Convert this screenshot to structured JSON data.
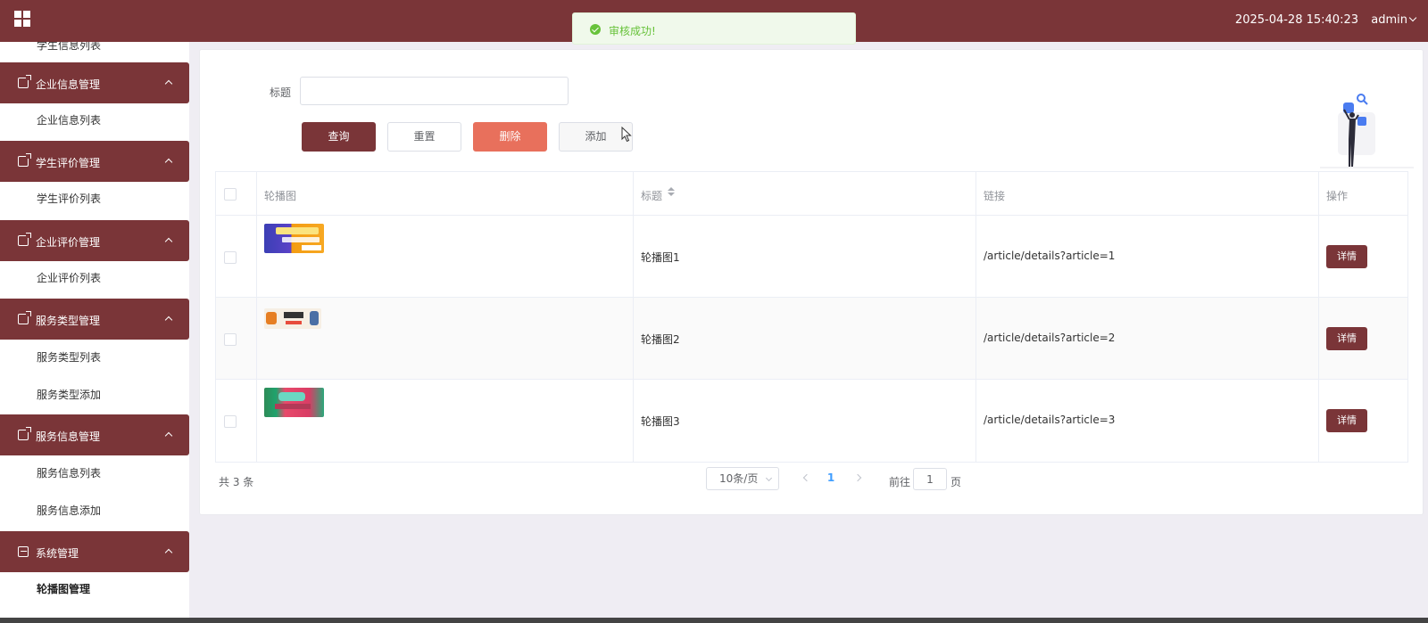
{
  "header": {
    "datetime": "2025-04-28 15:40:23",
    "user": "admin",
    "accent_color": "#7a3538"
  },
  "toast": {
    "message": "审核成功!",
    "icon": "success-check-icon"
  },
  "sidebar": {
    "top_partial_item": "学生信息列表",
    "groups": [
      {
        "label": "企业信息管理",
        "items": [
          "企业信息列表"
        ]
      },
      {
        "label": "学生评价管理",
        "items": [
          "学生评价列表"
        ]
      },
      {
        "label": "企业评价管理",
        "items": [
          "企业评价列表"
        ]
      },
      {
        "label": "服务类型管理",
        "items": [
          "服务类型列表",
          "服务类型添加"
        ]
      },
      {
        "label": "服务信息管理",
        "items": [
          "服务信息列表",
          "服务信息添加"
        ]
      },
      {
        "label": "系统管理",
        "items": [
          "轮播图管理"
        ]
      }
    ]
  },
  "search": {
    "title_label": "标题",
    "title_value": "",
    "buttons": {
      "query": "查询",
      "reset": "重置",
      "delete": "删除",
      "add": "添加"
    }
  },
  "table": {
    "columns": [
      "轮播图",
      "标题",
      "链接",
      "操作"
    ],
    "rows": [
      {
        "title": "轮播图1",
        "link": "/article/details?article=1",
        "action": "详情"
      },
      {
        "title": "轮播图2",
        "link": "/article/details?article=2",
        "action": "详情"
      },
      {
        "title": "轮播图3",
        "link": "/article/details?article=3",
        "action": "详情"
      }
    ]
  },
  "pagination": {
    "total": "共 3 条",
    "page_size": "10条/页",
    "current_page": "1",
    "goto_prefix": "前往",
    "goto_value": "1",
    "goto_suffix": "页"
  }
}
